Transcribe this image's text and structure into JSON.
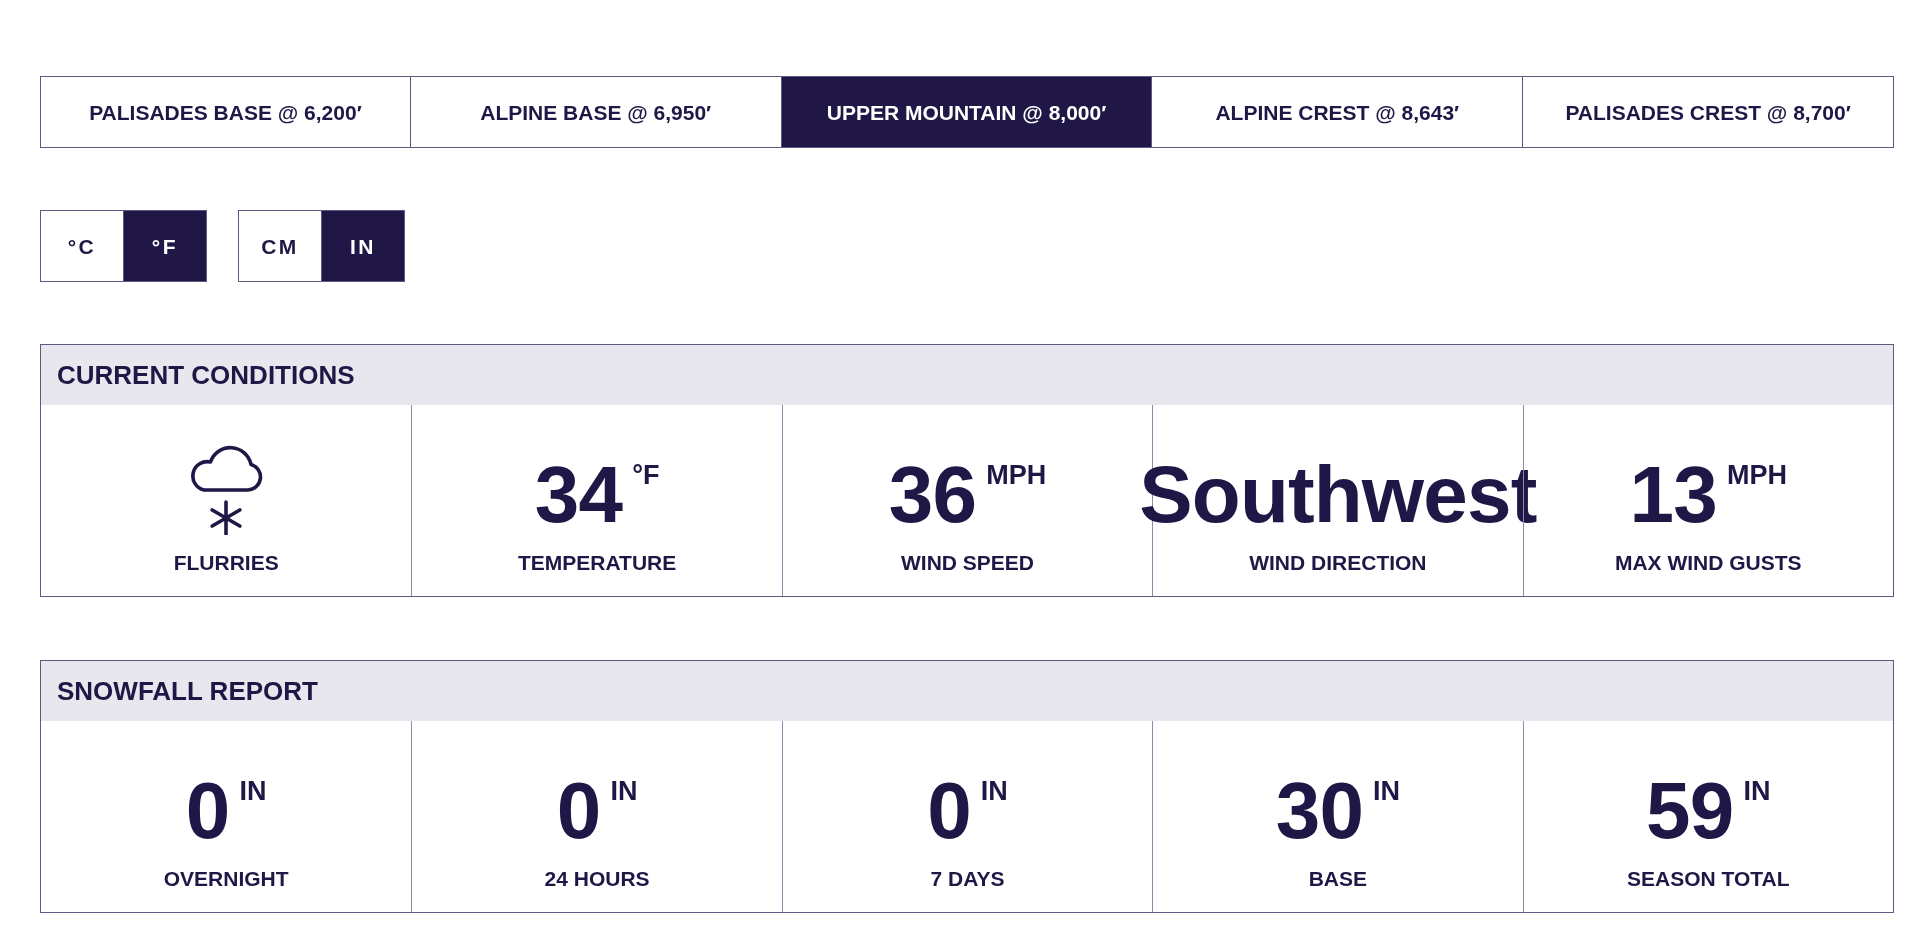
{
  "location_tabs": [
    {
      "label": "PALISADES BASE @ 6,200′",
      "selected": false
    },
    {
      "label": "ALPINE BASE @ 6,950′",
      "selected": false
    },
    {
      "label": "UPPER MOUNTAIN @ 8,000′",
      "selected": true
    },
    {
      "label": "ALPINE CREST @ 8,643′",
      "selected": false
    },
    {
      "label": "PALISADES CREST @ 8,700′",
      "selected": false
    }
  ],
  "unit_toggles": [
    {
      "options": [
        {
          "label": "°C",
          "selected": false
        },
        {
          "label": "°F",
          "selected": true
        }
      ]
    },
    {
      "options": [
        {
          "label": "CM",
          "selected": false
        },
        {
          "label": "IN",
          "selected": true
        }
      ]
    }
  ],
  "current_conditions": {
    "title": "CURRENT CONDITIONS",
    "items": [
      {
        "kind": "icon",
        "label": "FLURRIES"
      },
      {
        "kind": "value",
        "value": "34",
        "unit": "°F",
        "label": "TEMPERATURE"
      },
      {
        "kind": "value",
        "value": "36",
        "unit": "MPH",
        "label": "WIND SPEED"
      },
      {
        "kind": "value",
        "value": "Southwest",
        "label": "WIND DIRECTION"
      },
      {
        "kind": "value",
        "value": "13",
        "unit": "MPH",
        "label": "MAX WIND GUSTS"
      }
    ]
  },
  "snowfall_report": {
    "title": "SNOWFALL REPORT",
    "items": [
      {
        "kind": "value",
        "value": "0",
        "unit": "IN",
        "label": "OVERNIGHT"
      },
      {
        "kind": "value",
        "value": "0",
        "unit": "IN",
        "label": "24 HOURS"
      },
      {
        "kind": "value",
        "value": "0",
        "unit": "IN",
        "label": "7 DAYS"
      },
      {
        "kind": "value",
        "value": "30",
        "unit": "IN",
        "label": "BASE"
      },
      {
        "kind": "value",
        "value": "59",
        "unit": "IN",
        "label": "SEASON TOTAL"
      }
    ]
  }
}
